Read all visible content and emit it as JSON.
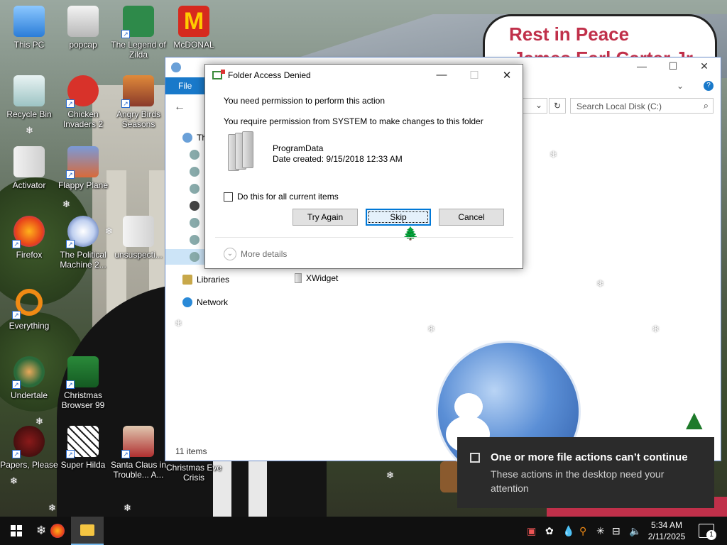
{
  "desktop": {
    "icons": [
      {
        "label": "This PC"
      },
      {
        "label": "popcap"
      },
      {
        "label": "The Legend of Zilda"
      },
      {
        "label": "McDONAL"
      },
      {
        "label": "Recycle Bin"
      },
      {
        "label": "Chicken Invaders 2"
      },
      {
        "label": "Angry Birds Seasons"
      },
      {
        "label": "Activator"
      },
      {
        "label": "Flappy Plane"
      },
      {
        "label": "Firefox"
      },
      {
        "label": "The Political Machine 2..."
      },
      {
        "label": "unsuspecti..."
      },
      {
        "label": "Everything"
      },
      {
        "label": "Undertale"
      },
      {
        "label": "Christmas Browser 99"
      },
      {
        "label": "Papers, Please"
      },
      {
        "label": "Super Hilda"
      },
      {
        "label": "Santa Claus in Trouble... A..."
      },
      {
        "label": "Christmas Eve Crisis"
      }
    ],
    "sign_line1": "Rest in Peace",
    "sign_line2": "James Earl Carter Jr."
  },
  "explorer": {
    "ribbon_file": "File",
    "search_placeholder": "Search Local Disk (C:)",
    "nav": {
      "libraries": "Libraries",
      "network": "Network",
      "this_pc": "Th"
    },
    "file_item": "XWidget",
    "status": "11 items"
  },
  "dialog": {
    "title": "Folder Access Denied",
    "message": "You need permission to perform this action",
    "detail": "You require permission from SYSTEM to make changes to this folder",
    "folder_name": "ProgramData",
    "folder_date": "Date created: 9/15/2018 12:33 AM",
    "checkbox_label": "Do this for all current items",
    "buttons": {
      "try_again": "Try Again",
      "skip": "Skip",
      "cancel": "Cancel"
    },
    "more_details": "More details"
  },
  "toast": {
    "title": "One or more file actions can’t continue",
    "body": "These actions in the desktop need your attention"
  },
  "taskbar": {
    "time": "5:34 AM",
    "date": "2/11/2025",
    "notification_count": "1"
  },
  "colors": {
    "accent": "#0078d7",
    "ribbon_file": "#1979ca",
    "taskbar": "#101010",
    "toast": "#2b2b2b"
  }
}
